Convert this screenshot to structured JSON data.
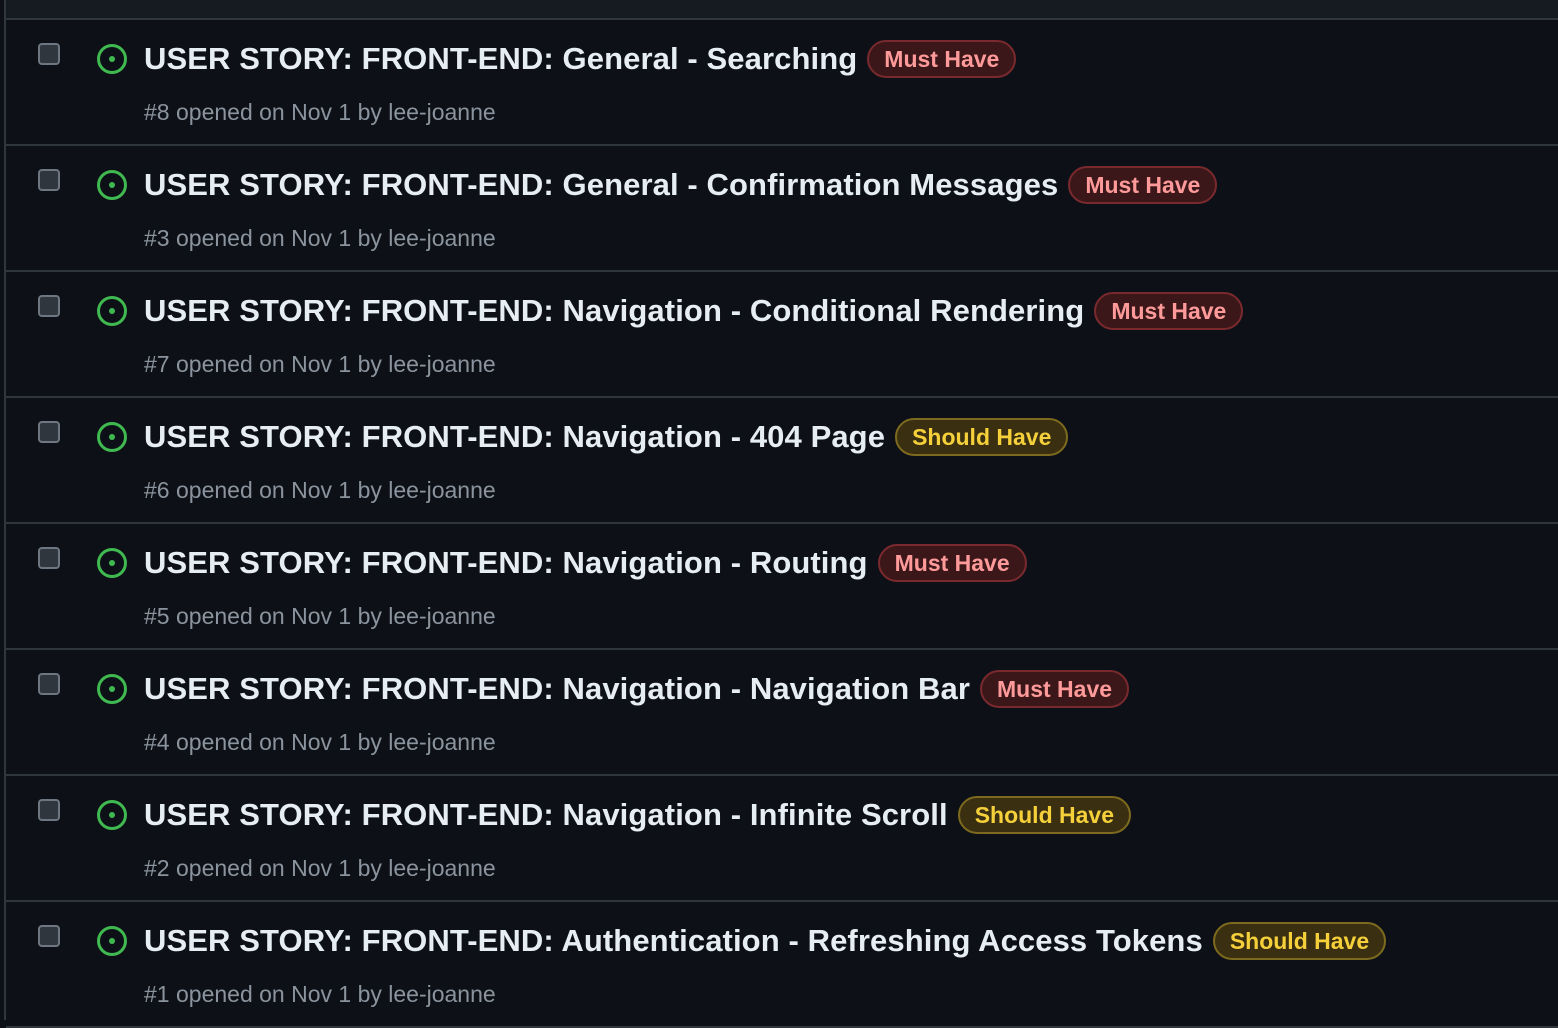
{
  "colors": {
    "background": "#0d1117",
    "open_icon": "#3fb950",
    "must_label_text": "#ff9a9a",
    "should_label_text": "#f5d03b",
    "muted_text": "#8b949e"
  },
  "icons": {
    "state": "issue-opened-icon"
  },
  "issues": [
    {
      "title": "USER STORY: FRONT-END: General - Searching",
      "label": "Must Have",
      "label_kind": "must",
      "number": "#8",
      "opened_text": "opened on Nov 1 by",
      "author": "lee-joanne"
    },
    {
      "title": "USER STORY: FRONT-END: General - Confirmation Messages",
      "label": "Must Have",
      "label_kind": "must",
      "number": "#3",
      "opened_text": "opened on Nov 1 by",
      "author": "lee-joanne"
    },
    {
      "title": "USER STORY: FRONT-END: Navigation - Conditional Rendering",
      "label": "Must Have",
      "label_kind": "must",
      "number": "#7",
      "opened_text": "opened on Nov 1 by",
      "author": "lee-joanne"
    },
    {
      "title": "USER STORY: FRONT-END: Navigation - 404 Page",
      "label": "Should Have",
      "label_kind": "should",
      "number": "#6",
      "opened_text": "opened on Nov 1 by",
      "author": "lee-joanne"
    },
    {
      "title": "USER STORY: FRONT-END: Navigation - Routing",
      "label": "Must Have",
      "label_kind": "must",
      "number": "#5",
      "opened_text": "opened on Nov 1 by",
      "author": "lee-joanne"
    },
    {
      "title": "USER STORY: FRONT-END: Navigation - Navigation Bar",
      "label": "Must Have",
      "label_kind": "must",
      "number": "#4",
      "opened_text": "opened on Nov 1 by",
      "author": "lee-joanne"
    },
    {
      "title": "USER STORY: FRONT-END: Navigation - Infinite Scroll",
      "label": "Should Have",
      "label_kind": "should",
      "number": "#2",
      "opened_text": "opened on Nov 1 by",
      "author": "lee-joanne"
    },
    {
      "title": "USER STORY: FRONT-END: Authentication - Refreshing Access Tokens",
      "label": "Should Have",
      "label_kind": "should",
      "number": "#1",
      "opened_text": "opened on Nov 1 by",
      "author": "lee-joanne"
    }
  ]
}
